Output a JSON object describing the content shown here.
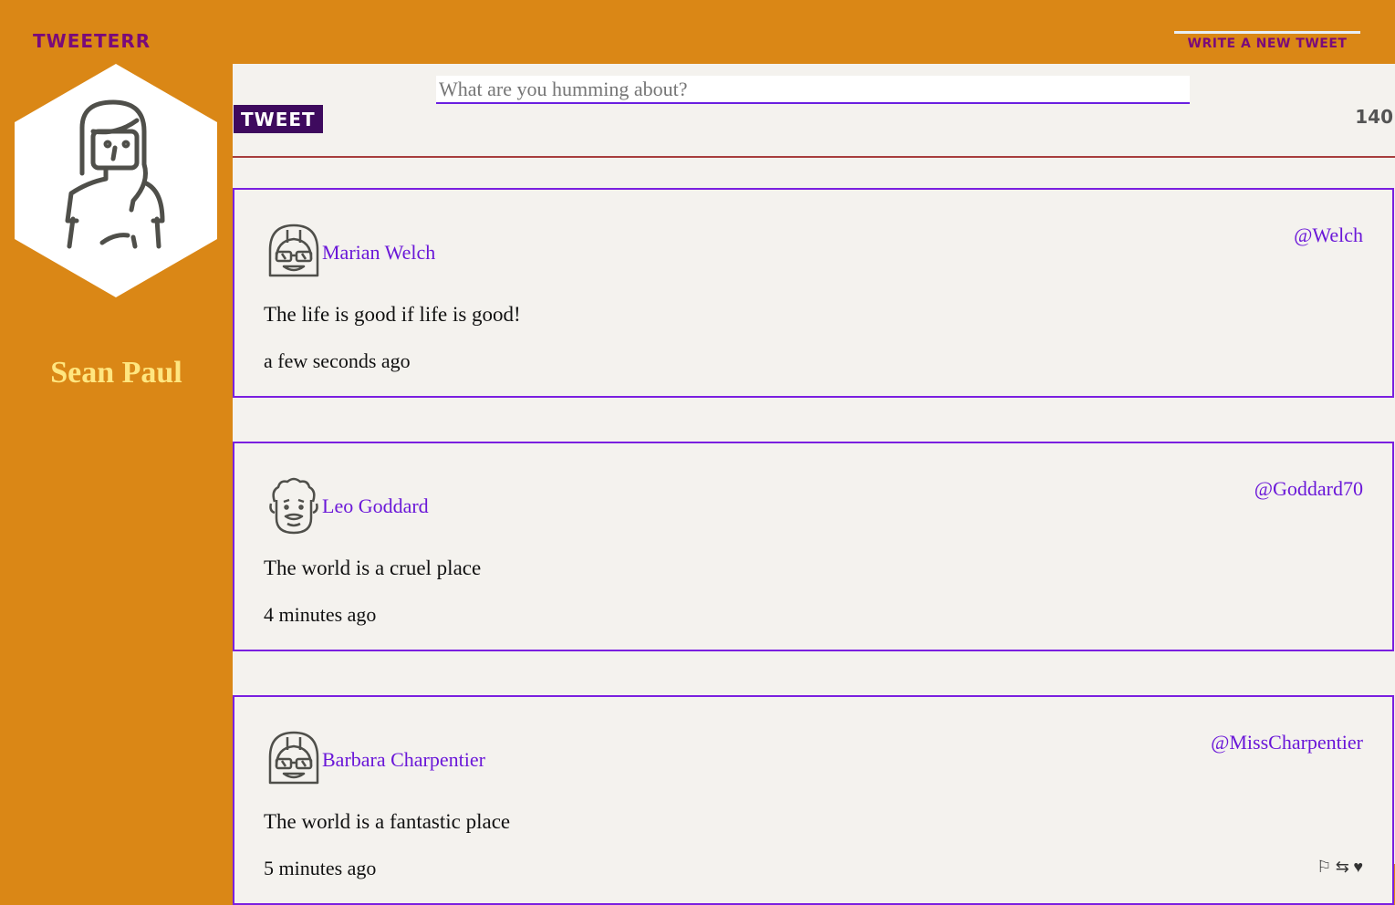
{
  "header": {
    "brand": "TWEETERR",
    "new_tweet_label": "WRITE A NEW TWEET"
  },
  "profile": {
    "name": "Sean Paul",
    "avatar_icon": "woman-avatar-icon"
  },
  "composer": {
    "placeholder": "What are you humming about?",
    "button_label": "TWEET",
    "counter": "140"
  },
  "tweets": [
    {
      "name": "Marian Welch",
      "handle": "@Welch",
      "text": "The life is good if life is good!",
      "time": "a few seconds ago",
      "avatar_icon": "woman-glasses-avatar-icon"
    },
    {
      "name": "Leo Goddard",
      "handle": "@Goddard70",
      "text": "The world is a cruel place",
      "time": "4 minutes ago",
      "avatar_icon": "man-curly-avatar-icon"
    },
    {
      "name": "Barbara Charpentier",
      "handle": "@MissCharpentier",
      "text": "The world is a fantastic place",
      "time": "5 minutes ago",
      "avatar_icon": "woman-glasses-avatar-icon"
    }
  ],
  "colors": {
    "sidebar": "#da8716",
    "accent": "#6a17d8",
    "brand": "#7a0a7a",
    "button": "#3e0a5e"
  }
}
